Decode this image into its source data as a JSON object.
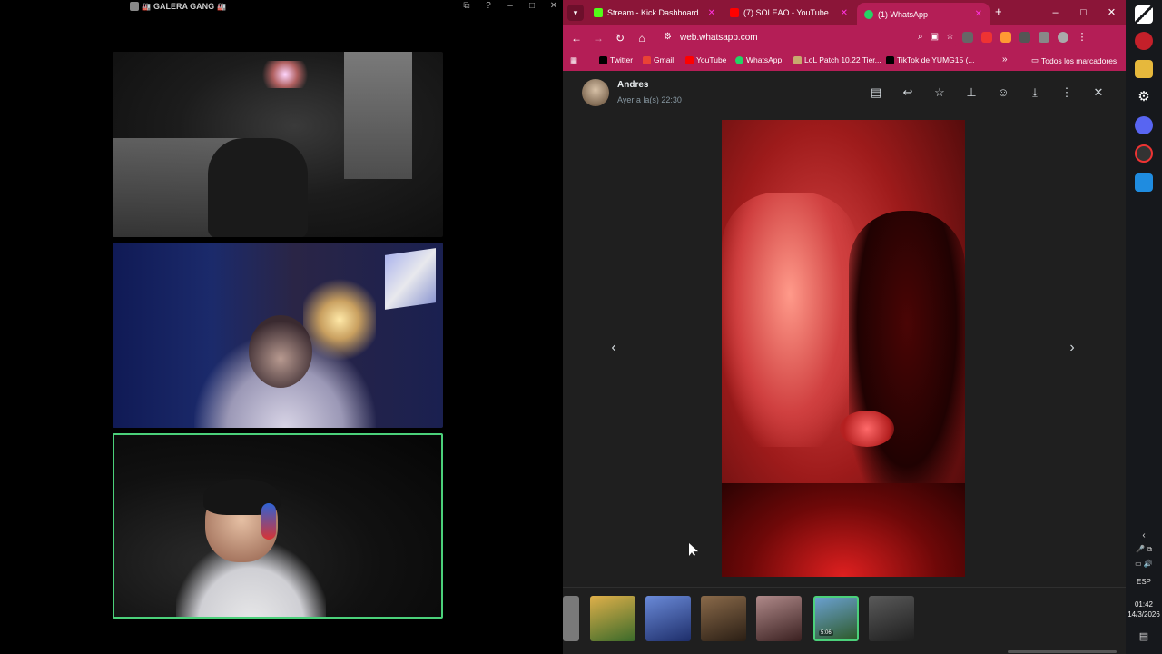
{
  "call_window": {
    "title": "GALERA GANG",
    "title_decor_left": "🏭",
    "title_decor_right": "🏭",
    "controls": [
      "⧉",
      "?",
      "–",
      "□",
      "✕"
    ]
  },
  "browser": {
    "tabs": [
      {
        "title": "Stream - Kick Dashboard",
        "favicon_color": "#53fc18"
      },
      {
        "title": "(7) SOLEAO - YouTube",
        "favicon_color": "#ff0000"
      },
      {
        "title": "(1) WhatsApp",
        "favicon_color": "#25d366",
        "active": true
      }
    ],
    "window_controls": [
      "–",
      "□",
      "✕"
    ],
    "url": "web.whatsapp.com",
    "bookmarks": [
      {
        "label": "Twitter",
        "icon_color": "#000000"
      },
      {
        "label": "Gmail",
        "icon_color": "#ea4335"
      },
      {
        "label": "YouTube",
        "icon_color": "#ff0000"
      },
      {
        "label": "WhatsApp",
        "icon_color": "#25d366"
      },
      {
        "label": "LoL Patch 10.22 Tier...",
        "icon_color": "#c8aa6e"
      },
      {
        "label": "TikTok de YUMG15 (...",
        "icon_color": "#000000"
      }
    ],
    "bookmarks_overflow": "»",
    "all_bookmarks": "Todos los marcadores"
  },
  "whatsapp": {
    "sender": "Andres",
    "timestamp": "Ayer a la(s) 22:30",
    "actions": [
      "message-icon",
      "reply-icon",
      "star-icon",
      "pin-icon",
      "emoji-icon",
      "download-icon",
      "menu-icon",
      "close-icon"
    ],
    "prev_arrow": "‹",
    "next_arrow": "›",
    "thumbnails": [
      {
        "kind": "partial",
        "color": "#7a7a7a"
      },
      {
        "kind": "image",
        "color": "#c48a2a"
      },
      {
        "kind": "image",
        "color": "#3a58a8"
      },
      {
        "kind": "image",
        "color": "#5a4632"
      },
      {
        "kind": "image",
        "color": "#7d5a5a"
      },
      {
        "kind": "video",
        "color": "#2c5a8a",
        "badge": "5:06",
        "selected": true
      },
      {
        "kind": "image",
        "color": "#3a3a3a"
      }
    ]
  },
  "taskbar": {
    "language": "ESP",
    "time": "01:42",
    "date": "14/3/2026"
  },
  "colors": {
    "chrome_theme": "#b41e56",
    "tabstrip": "#8b1538",
    "speaking_border": "#4bd07a",
    "viewer_bg": "#1f1f1f"
  }
}
